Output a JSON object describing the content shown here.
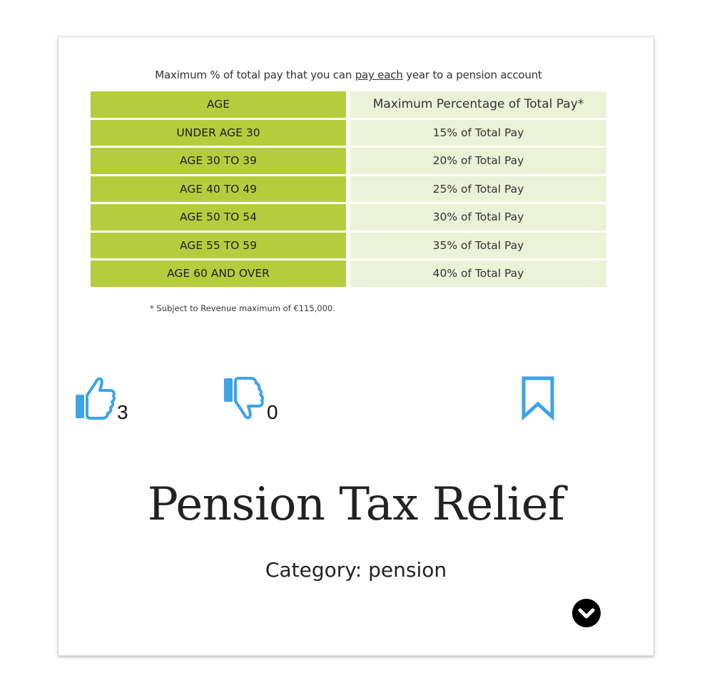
{
  "table_image": {
    "caption_pre": "Maximum % of total pay that you can ",
    "caption_underlined": "pay each",
    "caption_post": " year to a pension account",
    "header": {
      "age": "AGE",
      "percentage": "Maximum Percentage of Total Pay*"
    },
    "rows": [
      {
        "age": "UNDER AGE 30",
        "pct": "15% of Total Pay"
      },
      {
        "age": "AGE 30 TO 39",
        "pct": "20% of Total Pay"
      },
      {
        "age": "AGE 40 TO 49",
        "pct": "25% of Total Pay"
      },
      {
        "age": "AGE 50 TO 54",
        "pct": "30% of Total Pay"
      },
      {
        "age": "AGE 55 TO 59",
        "pct": "35% of Total Pay"
      },
      {
        "age": "AGE 60 AND OVER",
        "pct": "40% of Total Pay"
      }
    ],
    "footnote": "* Subject to Revenue maximum of €115,000.",
    "colors": {
      "age_cell": "#b5cd3d",
      "pct_cell": "#ecf2d7",
      "pct_header": "#ecf2d7"
    }
  },
  "actions": {
    "like": {
      "icon": "thumbs-up-icon",
      "count": "3"
    },
    "dislike": {
      "icon": "thumbs-down-icon",
      "count": "0"
    },
    "bookmark": {
      "icon": "bookmark-icon"
    },
    "icon_color": "#3ea3ea"
  },
  "post": {
    "title": "Pension Tax Relief",
    "category": "Category: pension"
  },
  "expand": {
    "icon": "chevron-down-icon"
  }
}
